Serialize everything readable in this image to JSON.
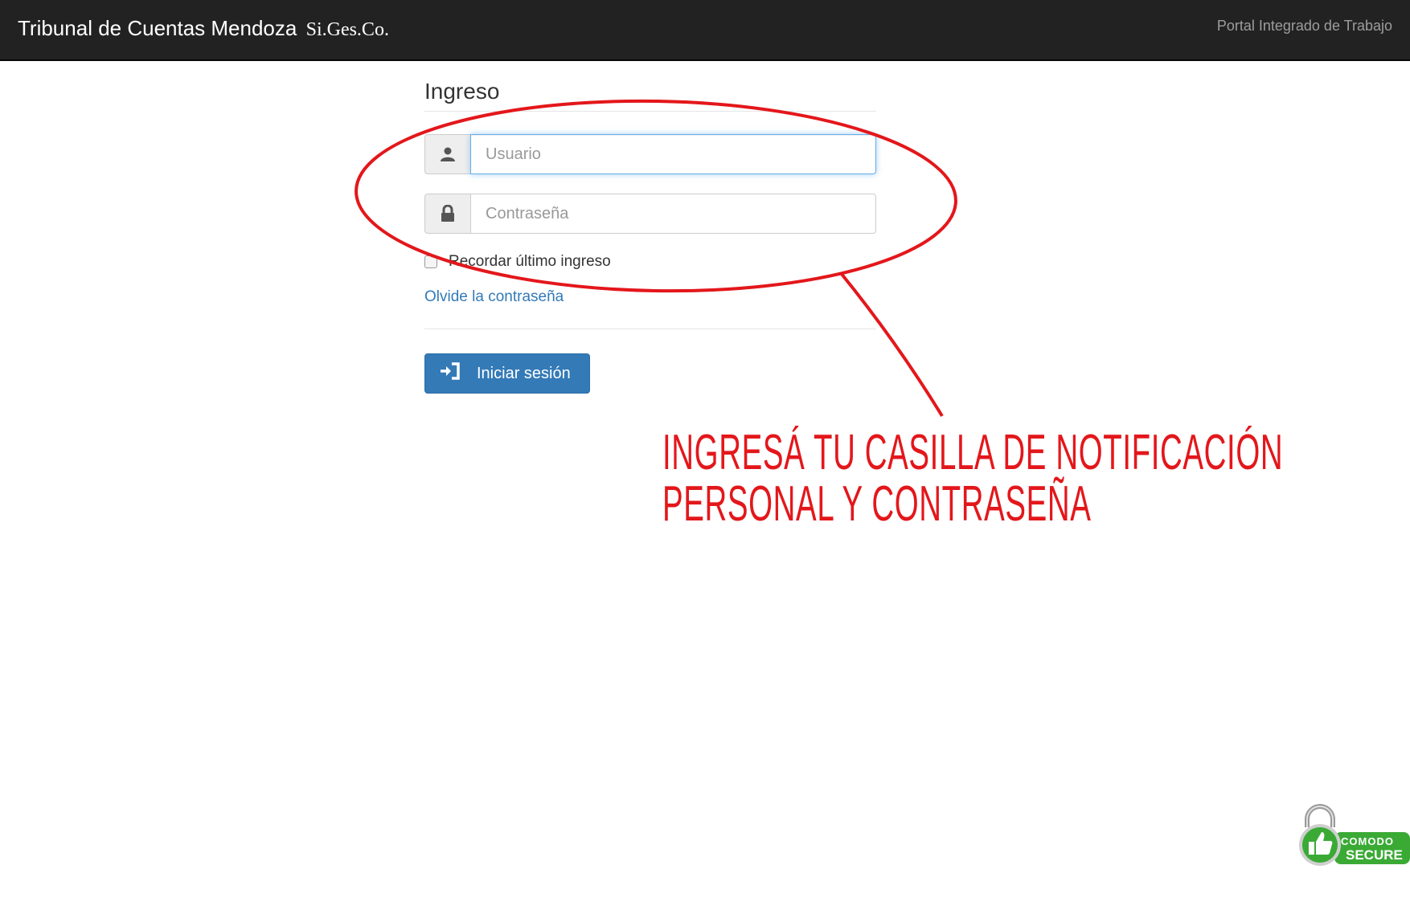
{
  "navbar": {
    "brand": "Tribunal de Cuentas Mendoza",
    "brand_sub": "Si.Ges.Co.",
    "right_link": "Portal Integrado de Trabajo"
  },
  "login": {
    "title": "Ingreso",
    "username_placeholder": "Usuario",
    "password_placeholder": "Contraseña",
    "remember_label": "Recordar último ingreso",
    "forgot_label": "Olvide la contraseña",
    "submit_label": "Iniciar sesión"
  },
  "annotation": {
    "line1": "Ingresá tu casilla de notificación",
    "line2": "personal y contraseña",
    "color": "#e3171b"
  },
  "badge": {
    "brand": "COMODO",
    "label": "SECURE",
    "color": "#3aaa35"
  },
  "icons": [
    "user-icon",
    "lock-icon",
    "login-icon",
    "thumbs-up-icon",
    "padlock-icon"
  ],
  "colors": {
    "navbar_bg": "#222222",
    "primary": "#337ab7",
    "focus": "#66afe9"
  }
}
